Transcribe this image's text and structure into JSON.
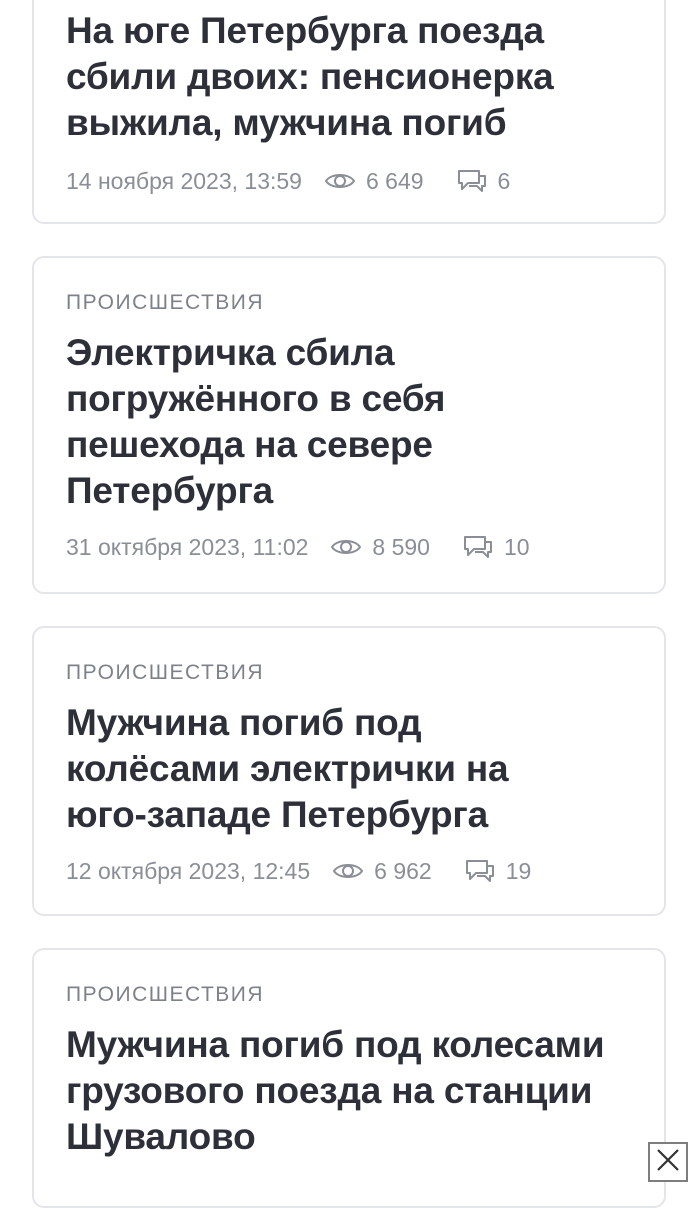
{
  "articles": [
    {
      "category": "",
      "title": "На юге Петербурга поезда сбили двоих: пенсионерка выжила, мужчина погиб",
      "date": "14 ноября 2023, 13:59",
      "views": "6 649",
      "comments": "6"
    },
    {
      "category": "ПРОИСШЕСТВИЯ",
      "title": "Электричка сбила погружённого в себя пешехода на севере Петербурга",
      "date": "31 октября 2023, 11:02",
      "views": "8 590",
      "comments": "10"
    },
    {
      "category": "ПРОИСШЕСТВИЯ",
      "title": "Мужчина погиб под колёсами электрички на юго-западе Петербурга",
      "date": "12 октября 2023, 12:45",
      "views": "6 962",
      "comments": "19"
    },
    {
      "category": "ПРОИСШЕСТВИЯ",
      "title": "Мужчина погиб под колесами грузового поезда на станции Шувалово",
      "date": "",
      "views": "",
      "comments": ""
    }
  ],
  "icons": {
    "views": "eye-icon",
    "comments": "comment-icon",
    "close": "close-icon"
  },
  "colors": {
    "title": "#2d3038",
    "meta": "#8a8e96",
    "border": "#e3e5e8"
  }
}
